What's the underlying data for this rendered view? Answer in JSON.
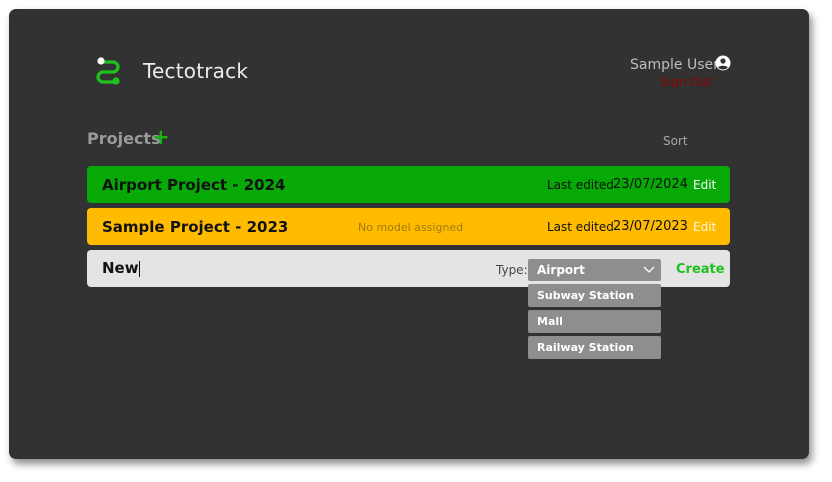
{
  "app": {
    "title": "Tectotrack",
    "logo_icon": "route-logo-icon",
    "accent_color": "#1fc11f"
  },
  "user": {
    "name": "Sample User",
    "icon": "user-circle-icon",
    "sign_out_label": "Sign Out"
  },
  "projects": {
    "heading": "Projects",
    "add_label": "+",
    "sort_label": "Sort",
    "items": [
      {
        "title": "Airport Project - 2024",
        "note": "",
        "last_edited_label": "Last edited",
        "date": "23/07/2024",
        "edit_label": "Edit",
        "color": "#06a906"
      },
      {
        "title": "Sample Project - 2023",
        "note": "No model assigned",
        "last_edited_label": "Last edited",
        "date": "23/07/2023",
        "edit_label": "Edit",
        "color": "#ffbb00"
      }
    ]
  },
  "new_project": {
    "name_value": "New",
    "type_label": "Type:",
    "selected_type": "Airport",
    "create_label": "Create",
    "options": [
      "Subway Station",
      "Mall",
      "Railway Station"
    ]
  }
}
